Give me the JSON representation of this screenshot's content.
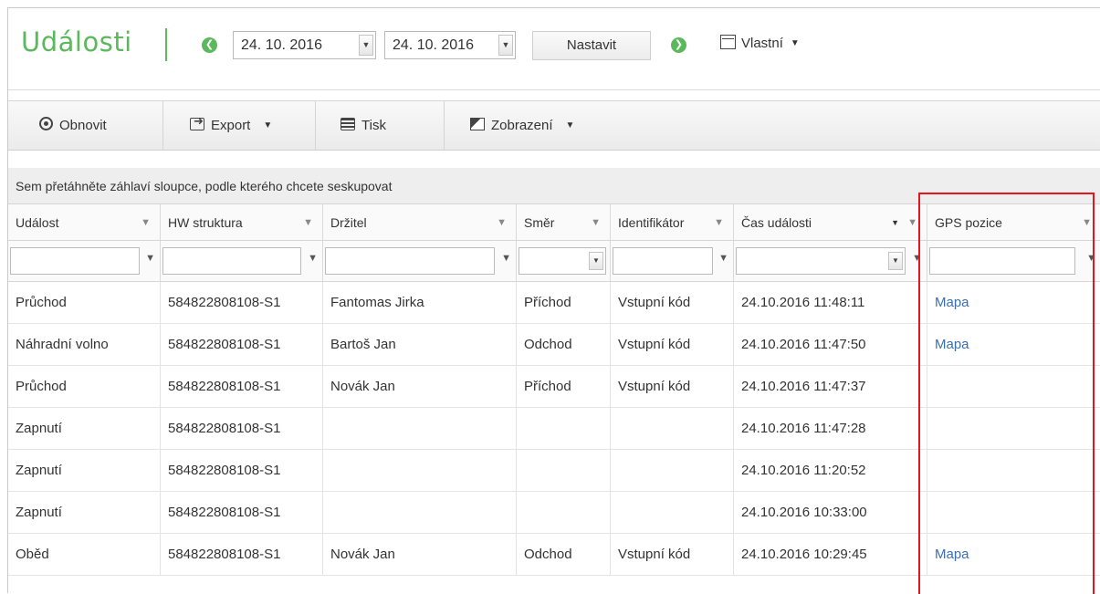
{
  "header": {
    "title": "Události",
    "date_from": "24. 10. 2016",
    "date_to": "24. 10. 2016",
    "set_label": "Nastavit",
    "range_label": "Vlastní"
  },
  "toolbar": {
    "refresh_label": "Obnovit",
    "export_label": "Export",
    "print_label": "Tisk",
    "view_label": "Zobrazení"
  },
  "group_panel_text": "Sem přetáhněte záhlaví sloupce, podle kterého chcete seskupovat",
  "columns": [
    "Událost",
    "HW struktura",
    "Držitel",
    "Směr",
    "Identifikátor",
    "Čas události",
    "GPS pozice"
  ],
  "rows": [
    [
      "Průchod",
      "584822808108-S1",
      "Fantomas Jirka",
      "Příchod",
      "Vstupní kód",
      "24.10.2016 11:48:11",
      "Mapa"
    ],
    [
      "Náhradní volno",
      "584822808108-S1",
      "Bartoš Jan",
      "Odchod",
      "Vstupní kód",
      "24.10.2016 11:47:50",
      "Mapa"
    ],
    [
      "Průchod",
      "584822808108-S1",
      "Novák Jan",
      "Příchod",
      "Vstupní kód",
      "24.10.2016 11:47:37",
      ""
    ],
    [
      "Zapnutí",
      "584822808108-S1",
      "",
      "",
      "",
      "24.10.2016 11:47:28",
      ""
    ],
    [
      "Zapnutí",
      "584822808108-S1",
      "",
      "",
      "",
      "24.10.2016 11:20:52",
      ""
    ],
    [
      "Zapnutí",
      "584822808108-S1",
      "",
      "",
      "",
      "24.10.2016 10:33:00",
      ""
    ],
    [
      "Oběd",
      "584822808108-S1",
      "Novák Jan",
      "Odchod",
      "Vstupní kód",
      "24.10.2016 10:29:45",
      "Mapa"
    ]
  ],
  "colors": {
    "accent_green": "#5cb85c",
    "link_blue": "#3a6fb0",
    "highlight_red": "#e8141b"
  }
}
